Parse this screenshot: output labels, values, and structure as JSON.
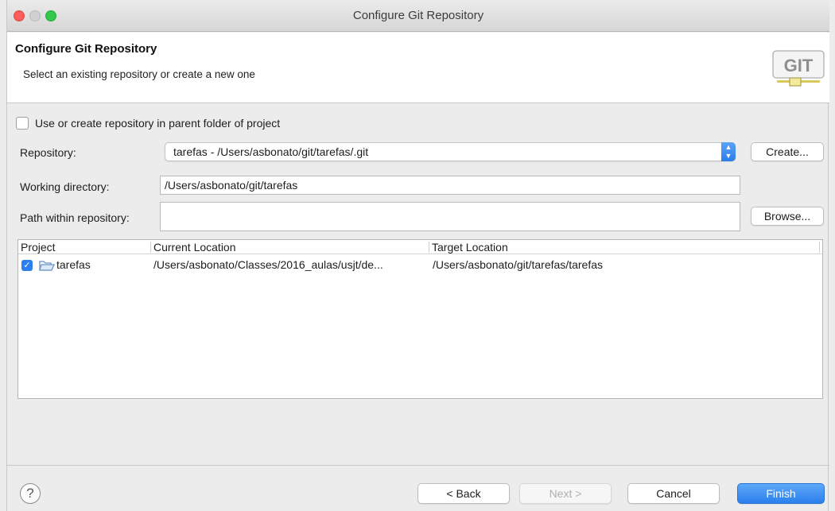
{
  "window": {
    "title": "Configure Git Repository"
  },
  "banner": {
    "title": "Configure Git Repository",
    "subtitle": "Select an existing repository or create a new one",
    "logo_text": "GIT"
  },
  "form": {
    "parent_folder_checkbox_label": "Use or create repository in parent folder of project",
    "parent_folder_checked": false,
    "repository_label": "Repository:",
    "repository_value": "tarefas - /Users/asbonato/git/tarefas/.git",
    "create_button": "Create...",
    "working_dir_label": "Working directory:",
    "working_dir_value": "/Users/asbonato/git/tarefas",
    "path_label": "Path within repository:",
    "path_value": "",
    "browse_button": "Browse..."
  },
  "table": {
    "columns": [
      "Project",
      "Current Location",
      "Target Location"
    ],
    "rows": [
      {
        "checked": true,
        "project": "tarefas",
        "current": "/Users/asbonato/Classes/2016_aulas/usjt/de...",
        "target": "/Users/asbonato/git/tarefas/tarefas"
      }
    ]
  },
  "footer": {
    "help_symbol": "?",
    "back": "< Back",
    "next": "Next >",
    "cancel": "Cancel",
    "finish": "Finish"
  },
  "colors": {
    "accent": "#2a80ec",
    "close": "#fc605c",
    "maximize": "#34c84a"
  }
}
